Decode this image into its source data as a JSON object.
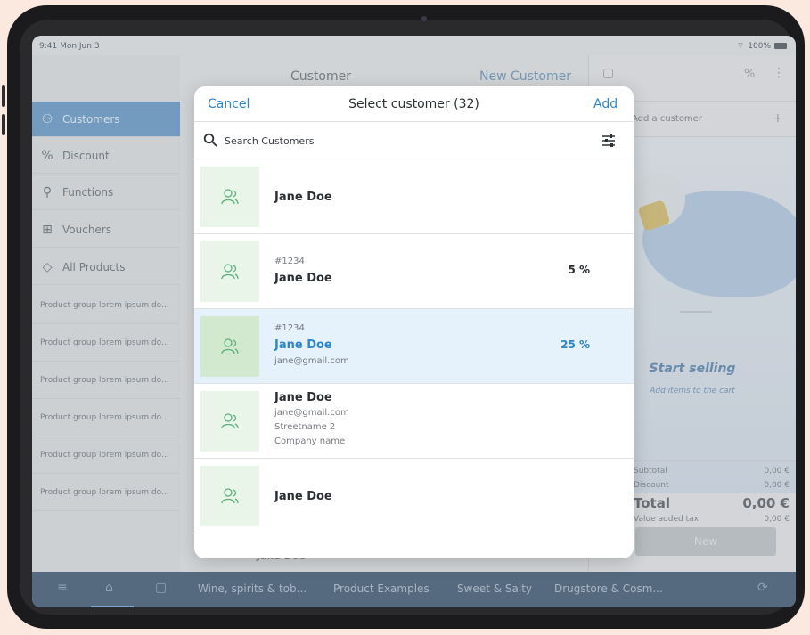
{
  "status": {
    "time": "9:41  Mon Jun 3",
    "battery": "100%"
  },
  "sidebar": {
    "items": [
      {
        "label": "Customers",
        "icon": "customers-icon"
      },
      {
        "label": "Discount",
        "icon": "percent-icon"
      },
      {
        "label": "Functions",
        "icon": "wrench-icon"
      },
      {
        "label": "Vouchers",
        "icon": "gift-icon"
      },
      {
        "label": "All Products",
        "icon": "tag-icon"
      }
    ],
    "groups": [
      "Product group lorem ipsum do...",
      "Product group lorem ipsum do...",
      "Product group lorem ipsum do...",
      "Product group lorem ipsum do...",
      "Product group lorem ipsum do...",
      "Product group lorem ipsum do..."
    ]
  },
  "middle": {
    "title": "Customer",
    "new_customer": "New Customer",
    "bottom_peek": "Jane Doe"
  },
  "right": {
    "add_customer": "Add a customer",
    "start_selling": "Start selling",
    "add_items": "Add items to the cart",
    "subtotal_label": "Subtotal",
    "subtotal_value": "0,00 €",
    "discount_label": "Discount",
    "discount_value": "0,00 €",
    "total_label": "Total",
    "total_value": "0,00 €",
    "tax_label": "Value added tax",
    "tax_value": "0,00 €",
    "new_button": "New"
  },
  "bottombar": {
    "categories": [
      "Wine, spirits & tob...",
      "Product Examples",
      "Sweet & Salty",
      "Drugstore & Cosm..."
    ]
  },
  "modal": {
    "cancel": "Cancel",
    "title": "Select customer (32)",
    "add": "Add",
    "search_placeholder": "Search Customers",
    "customers": [
      {
        "id": "",
        "name": "Jane Doe",
        "email": "",
        "street": "",
        "company": "",
        "discount": ""
      },
      {
        "id": "#1234",
        "name": "Jane Doe",
        "email": "",
        "street": "",
        "company": "",
        "discount": "5 %"
      },
      {
        "id": "#1234",
        "name": "Jane Doe",
        "email": "jane@gmail.com",
        "street": "",
        "company": "",
        "discount": "25 %"
      },
      {
        "id": "",
        "name": "Jane Doe",
        "email": "jane@gmail.com",
        "street": "Streetname 2",
        "company": "Company name",
        "discount": ""
      },
      {
        "id": "",
        "name": "Jane Doe",
        "email": "",
        "street": "",
        "company": "",
        "discount": ""
      }
    ]
  },
  "colors": {
    "accent": "#2e86c8",
    "avatar_bg": "#eaf5ea",
    "selected_bg": "#e5f1fb",
    "bottombar": "#5a6f86"
  }
}
